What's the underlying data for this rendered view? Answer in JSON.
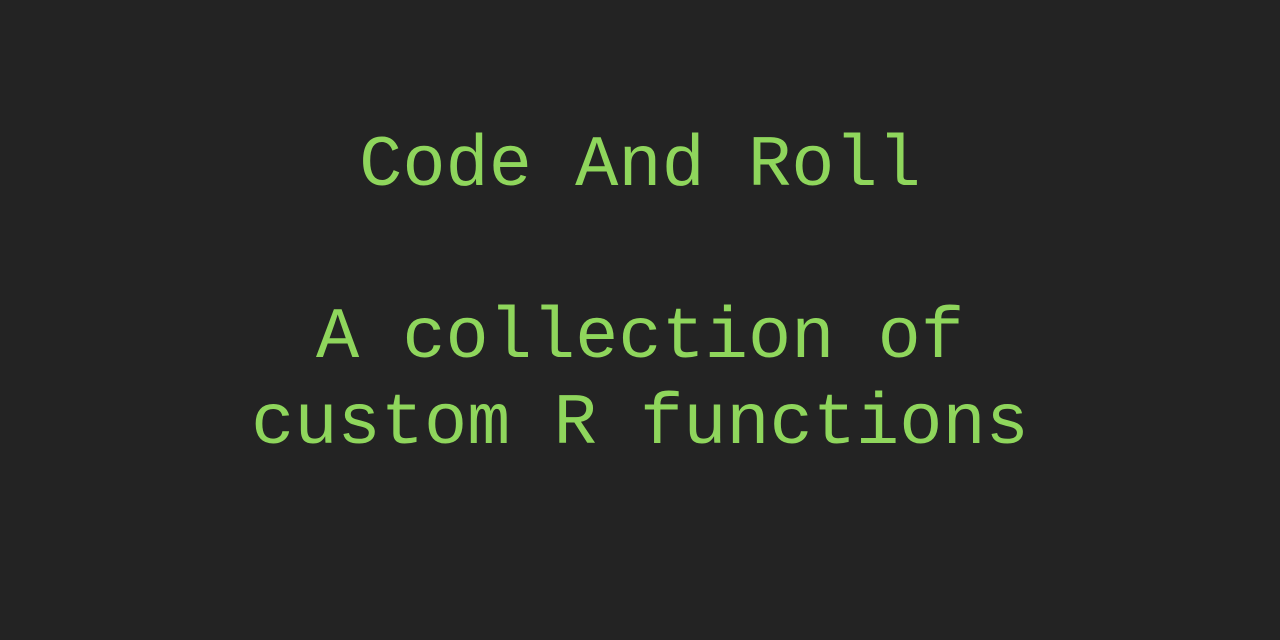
{
  "banner": {
    "title": "Code And Roll",
    "subtitle_line1": "A collection of",
    "subtitle_line2": "custom R functions",
    "text_color": "#8fd65c",
    "background_color": "#232323"
  }
}
